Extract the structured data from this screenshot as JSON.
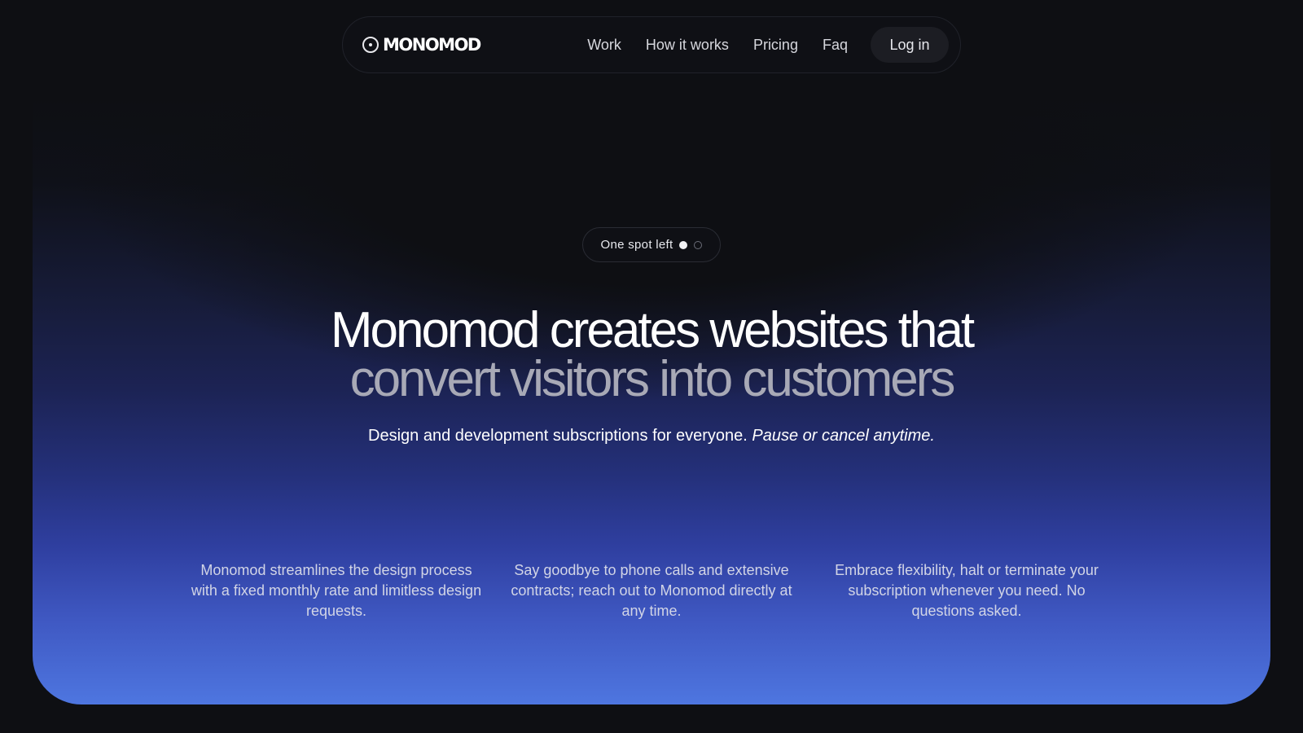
{
  "nav": {
    "brand": "MONOMOD",
    "links": [
      "Work",
      "How it works",
      "Pricing",
      "Faq"
    ],
    "login_label": "Log in"
  },
  "hero": {
    "availability": "One spot left",
    "headline_line1": "Monomod creates websites that",
    "headline_line2": "convert visitors into customers",
    "subheadline_main": "Design and development subscriptions for everyone.",
    "subheadline_italic": "Pause or cancel anytime."
  },
  "features": [
    "Monomod streamlines the design process with a fixed monthly rate and limitless design requests.",
    "Say goodbye to phone calls and extensive contracts; reach out to Monomod directly at any time.",
    "Embrace flexibility, halt or terminate your subscription whenever you need. No questions asked."
  ],
  "colors": {
    "background": "#0e0f13",
    "gradient_bottom": "#4e76e0",
    "headline_secondary": "#a8a9b6"
  },
  "icons": {
    "logo": "circle-dot-logo-icon",
    "availability_filled": "filled-dot-icon",
    "availability_empty": "empty-dot-icon"
  }
}
